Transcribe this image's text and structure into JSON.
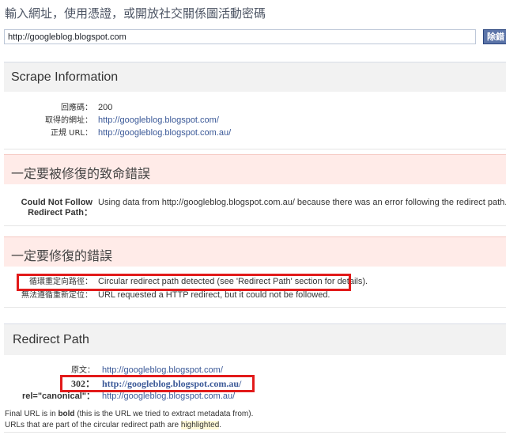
{
  "header": {
    "title": "輸入網址，使用憑證，或開放社交關係圖活動密碼"
  },
  "input": {
    "value": "http://googleblog.blogspot.com",
    "button_label": "除錯"
  },
  "scrape": {
    "title": "Scrape Information",
    "rows": [
      {
        "label": "回應碼：",
        "value": "200"
      },
      {
        "label": "取得的網址：",
        "value": "http://googleblog.blogspot.com/"
      },
      {
        "label": "正規 URL：",
        "value": "http://googleblog.blogspot.com.au/"
      }
    ]
  },
  "critical": {
    "title": "一定要被修復的致命錯誤",
    "label_line1": "Could Not Follow",
    "label_line2": "Redirect Path：",
    "message": "Using data from http://googleblog.blogspot.com.au/ because there was an error following the redirect path."
  },
  "errors": {
    "title": "一定要修復的錯誤",
    "rows": [
      {
        "label": "循環重定向路徑：",
        "value": "Circular redirect path detected (see 'Redirect Path' section for details)."
      },
      {
        "label": "無法遵循重新定位：",
        "value": "URL requested a HTTP redirect, but it could not be followed."
      }
    ]
  },
  "redirect": {
    "title": "Redirect Path",
    "rows": [
      {
        "label": "原文：",
        "value": "http://googleblog.blogspot.com/"
      },
      {
        "label": "302：",
        "value": "http://googleblog.blogspot.com.au/"
      },
      {
        "label": "rel=\"canonical\"：",
        "value": "http://googleblog.blogspot.com.au/"
      }
    ],
    "note1_pre": "Final URL is in ",
    "note1_bold": "bold",
    "note1_post": " (this is the URL we tried to extract metadata from).",
    "note2_pre": "URLs that are part of the circular redirect path are ",
    "note2_hl": "highlighted",
    "note2_post": "."
  },
  "colors": {
    "link": "#3b5998",
    "error_bg": "#ffebe8",
    "highlight_border": "#e21a1a"
  }
}
